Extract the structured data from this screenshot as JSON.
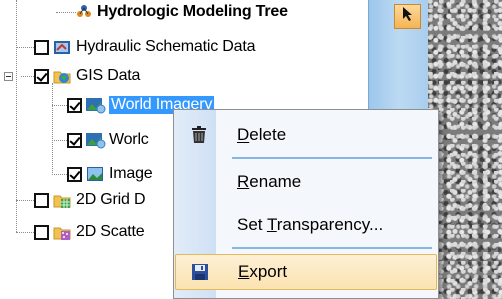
{
  "tree": {
    "header": "Hydrologic Modeling Tree",
    "items": [
      {
        "label": "Hydraulic Schematic Data",
        "checked": false,
        "icon": "hydraulic-schematic-icon"
      },
      {
        "label": "GIS Data",
        "checked": true,
        "icon": "globe-folder-icon"
      },
      {
        "label": "World Imagery",
        "visible_label": "World Imagery",
        "checked": true,
        "icon": "world-imagery-icon",
        "selected": true
      },
      {
        "label": "Worlc",
        "checked": true,
        "icon": "world-imagery-icon"
      },
      {
        "label": "Image",
        "checked": true,
        "icon": "image-icon"
      },
      {
        "label": "2D Grid D",
        "checked": false,
        "icon": "grid-folder-icon"
      },
      {
        "label": "2D Scatte",
        "checked": false,
        "icon": "scatter-folder-icon"
      }
    ]
  },
  "toolbar": {
    "select_tool_icon": "arrow-cursor-icon"
  },
  "context_menu": {
    "items": [
      {
        "label": "Delete",
        "mnemonic": "D",
        "icon": "trash-icon"
      },
      {
        "label": "Rename",
        "mnemonic": "R",
        "icon": ""
      },
      {
        "label": "Set Transparency...",
        "mnemonic": "T",
        "icon": ""
      },
      {
        "label": "Export",
        "mnemonic": "E",
        "icon": "floppy-disk-icon",
        "highlighted": true
      }
    ]
  },
  "colors": {
    "selection": "#3399ff",
    "menu_highlight": "#fbe2b0",
    "toolbar_button": "#f6b453",
    "separator": "#88b6e2"
  }
}
